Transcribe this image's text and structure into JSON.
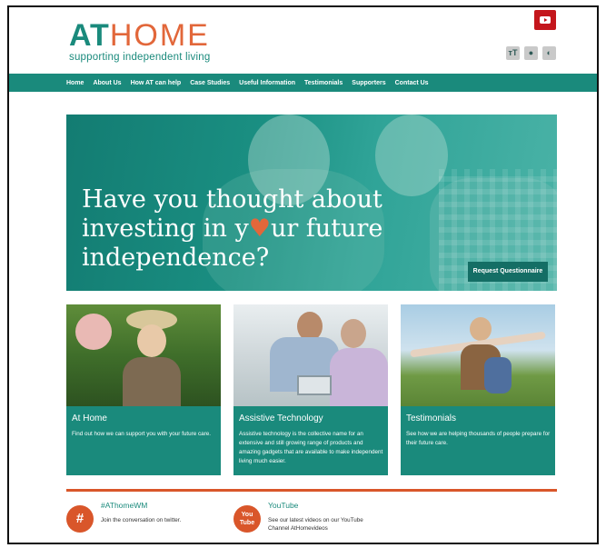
{
  "header": {
    "logo_at": "AT",
    "logo_home": "HOME",
    "logo_sub": "supporting independent living",
    "youtube_icon": "youtube-icon",
    "a11y": [
      {
        "name": "text-size-icon",
        "glyph": "тT"
      },
      {
        "name": "contrast-drop-icon",
        "glyph": "●"
      },
      {
        "name": "contrast-toggle-icon",
        "glyph": "◐"
      }
    ]
  },
  "nav": {
    "items": [
      "Home",
      "About Us",
      "How AT can help",
      "Case Studies",
      "Useful Information",
      "Testimonials",
      "Supporters",
      "Contact Us"
    ]
  },
  "hero": {
    "line1": "Have you thought about",
    "line2_a": "investing in y",
    "line2_heart": "♥",
    "line2_b": "ur future",
    "line3": "independence?",
    "button": "Request Questionnaire"
  },
  "cards": [
    {
      "title": "At Home",
      "text": "Find out how we can support you with your future care."
    },
    {
      "title": "Assistive Technology",
      "text": "Assistive technology is the collective name for an extensive and still growing range of products and amazing gadgets that are available to make independent living much easier."
    },
    {
      "title": "Testimonials",
      "text": "See how we are helping thousands of people prepare for their future care."
    }
  ],
  "social": {
    "twitter": {
      "icon": "hashtag-icon",
      "glyph": "#",
      "title": "#AThomeWM",
      "text": "Join the conversation on twitter."
    },
    "youtube": {
      "icon": "youtube-icon",
      "glyph": "You Tube",
      "title": "YouTube",
      "text": "See our latest videos on our YouTube Channel AtHomevideos"
    }
  },
  "colors": {
    "teal": "#1a8a7c",
    "orange": "#e2673a",
    "youtube_red": "#c4161c"
  }
}
